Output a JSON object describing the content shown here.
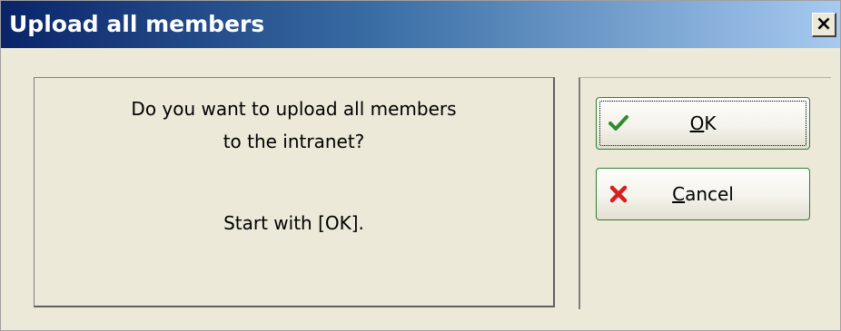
{
  "window": {
    "title": "Upload all members",
    "close_label": "×"
  },
  "message": {
    "line1": "Do you want to upload all members",
    "line2": "to the intranet?",
    "line3": "Start with [OK]."
  },
  "buttons": {
    "ok": {
      "accel": "O",
      "rest": "K",
      "icon": "checkmark-icon",
      "color": "#2e8b2e"
    },
    "cancel": {
      "accel": "C",
      "rest": "ancel",
      "icon": "red-x-icon",
      "color": "#d81e1e"
    }
  }
}
